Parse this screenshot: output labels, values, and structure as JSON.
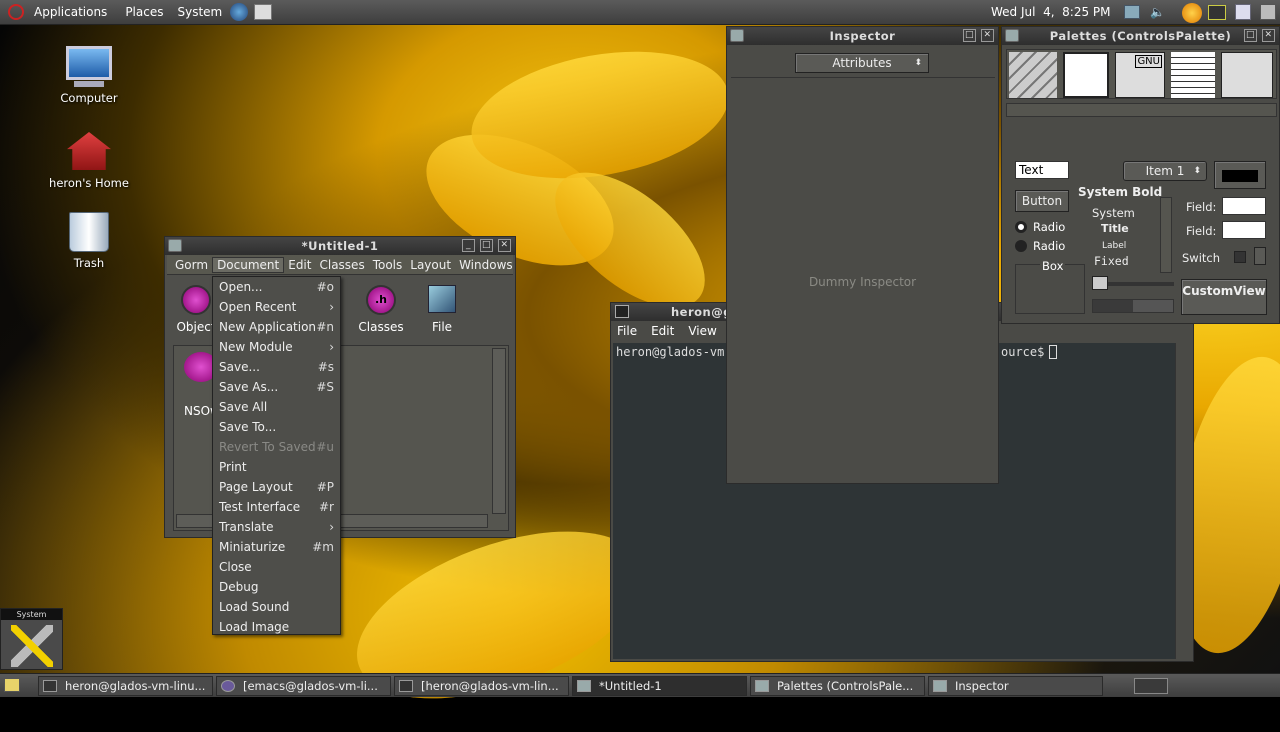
{
  "top_panel": {
    "menus": [
      "Applications",
      "Places",
      "System"
    ],
    "clock": "Wed Jul  4,  8:25 PM"
  },
  "desktop_icons": [
    {
      "label": "Computer"
    },
    {
      "label": "heron's Home"
    },
    {
      "label": "Trash"
    }
  ],
  "gorm_window": {
    "title": "*Untitled-1",
    "menubar": [
      "Gorm",
      "Document",
      "Edit",
      "Classes",
      "Tools",
      "Layout",
      "Windows"
    ],
    "icons": [
      {
        "label": "Object"
      },
      {
        "label": "Classes",
        "glyph": ".h"
      },
      {
        "label": "File"
      }
    ],
    "object_label": "NSOw"
  },
  "document_menu": {
    "items": [
      {
        "label": "Open...",
        "shortcut": "#o"
      },
      {
        "label": "Open Recent",
        "shortcut": "›"
      },
      {
        "label": "New Application",
        "shortcut": "#n"
      },
      {
        "label": "New Module",
        "shortcut": "›"
      },
      {
        "label": "Save...",
        "shortcut": "#s"
      },
      {
        "label": "Save As...",
        "shortcut": "#S"
      },
      {
        "label": "Save All",
        "shortcut": ""
      },
      {
        "label": "Save To...",
        "shortcut": ""
      },
      {
        "label": "Revert To Saved",
        "shortcut": "#u",
        "disabled": true
      },
      {
        "label": "Print",
        "shortcut": ""
      },
      {
        "label": "Page Layout",
        "shortcut": "#P"
      },
      {
        "label": "Test Interface",
        "shortcut": "#r"
      },
      {
        "label": "Translate",
        "shortcut": "›"
      },
      {
        "label": "Miniaturize",
        "shortcut": "#m"
      },
      {
        "label": "Close",
        "shortcut": ""
      },
      {
        "label": "Debug",
        "shortcut": ""
      },
      {
        "label": "Load Sound",
        "shortcut": ""
      },
      {
        "label": "Load Image",
        "shortcut": ""
      }
    ]
  },
  "terminal": {
    "title": "heron@g",
    "menus": [
      "File",
      "Edit",
      "View"
    ],
    "prompt_left": "heron@glados-vm-",
    "prompt_right": "ource$"
  },
  "inspector": {
    "title": "Inspector",
    "popup": "Attributes",
    "placeholder": "Dummy Inspector"
  },
  "palettes": {
    "title": "Palettes (ControlsPalette)",
    "text_field": "Text",
    "popup_item": "Item 1",
    "button": "Button",
    "radio1": "Radio",
    "radio2": "Radio",
    "box": "Box",
    "fonts": {
      "bold": "System Bold",
      "system": "System",
      "title": "Title",
      "label": "Label",
      "fixed": "Fixed"
    },
    "field1": "Field:",
    "field2": "Field:",
    "switch": "Switch",
    "custom_view": "CustomView",
    "gnu": "GNU"
  },
  "mini_window": {
    "label": "System"
  },
  "taskbar": [
    {
      "label": "heron@glados-vm-linu..."
    },
    {
      "label": "[emacs@glados-vm-li..."
    },
    {
      "label": "[heron@glados-vm-lin..."
    },
    {
      "label": "*Untitled-1"
    },
    {
      "label": "Palettes (ControlsPale..."
    },
    {
      "label": "Inspector"
    }
  ],
  "colors": {
    "panel": "#4a4a4a",
    "window": "#4f4f4b",
    "terminal_bg": "#2e3436",
    "accent_magenta": "#c0009a"
  }
}
